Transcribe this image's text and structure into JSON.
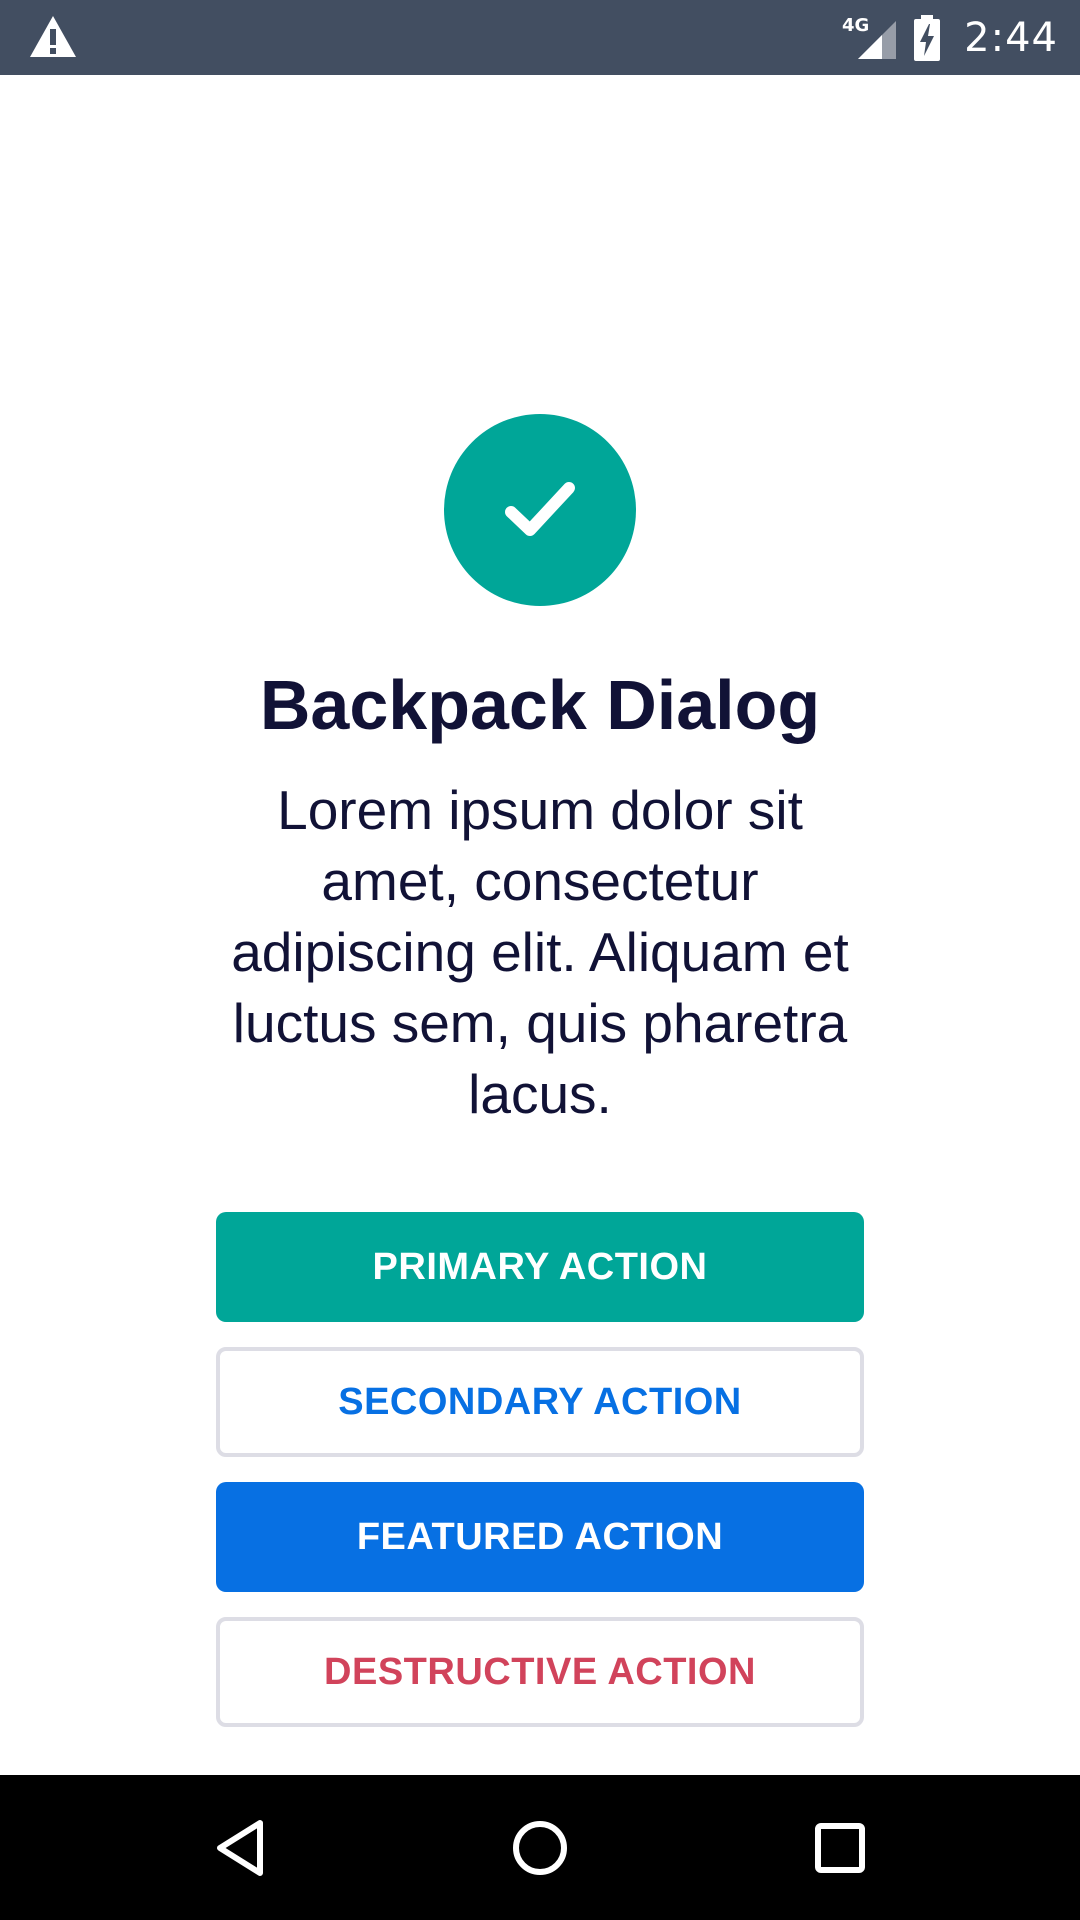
{
  "status_bar": {
    "network": "4G",
    "time": "2:44",
    "icons": [
      "warning-icon",
      "signal-icon",
      "battery-charging-icon"
    ],
    "background": "#424e61"
  },
  "dialog": {
    "icon": "checkmark-icon",
    "icon_color": "#00a698",
    "title": "Backpack Dialog",
    "body": "Lorem ipsum dolor sit amet, consectetur adipiscing elit. Aliquam et luctus sem, quis pharetra lacus.",
    "buttons": [
      {
        "label": "PRIMARY ACTION",
        "style": "primary",
        "color": "#00a698"
      },
      {
        "label": "SECONDARY ACTION",
        "style": "secondary",
        "color": "#0770e3"
      },
      {
        "label": "FEATURED ACTION",
        "style": "featured",
        "color": "#0770e3"
      },
      {
        "label": "DESTRUCTIVE ACTION",
        "style": "destructive",
        "color": "#d1435b"
      }
    ]
  },
  "nav_bar": {
    "icons": [
      "back-icon",
      "home-icon",
      "recents-icon"
    ]
  }
}
